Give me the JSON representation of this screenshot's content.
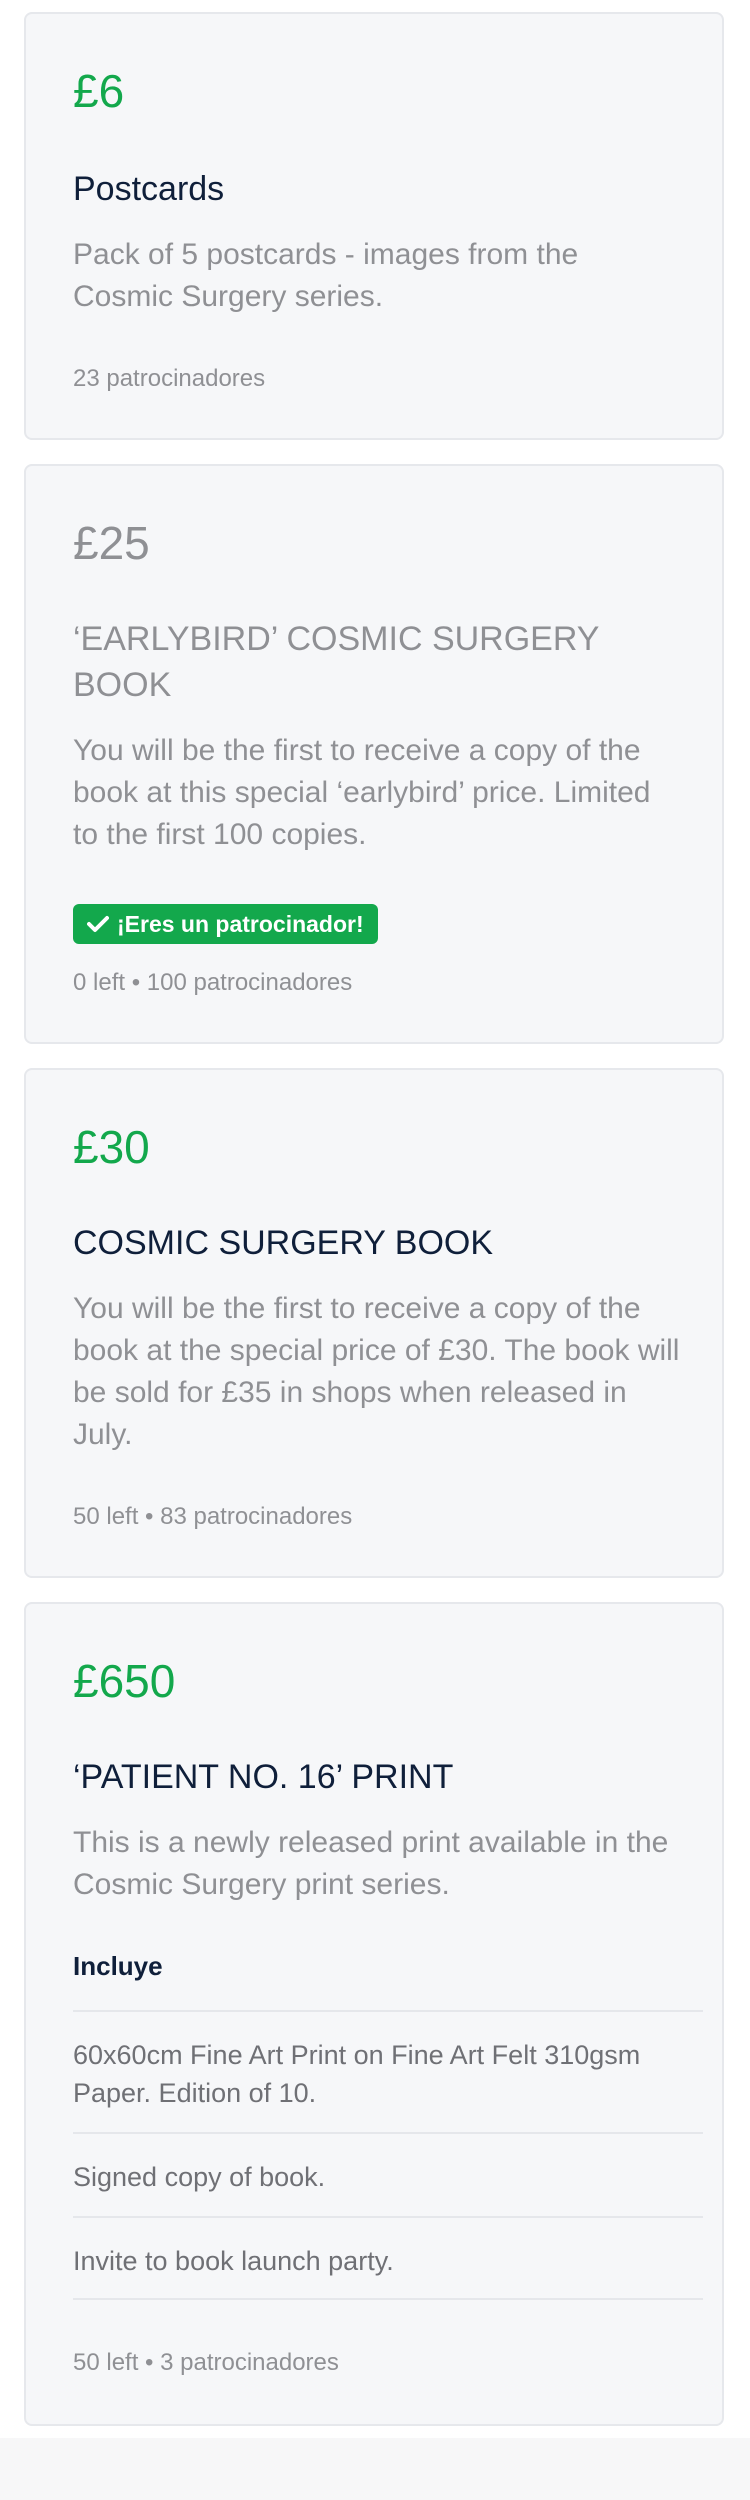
{
  "rewards": [
    {
      "price": "£6",
      "title": "Postcards",
      "description": "Pack of 5 postcards - images from the Cosmic Surgery series.",
      "meta": "23 patrocinadores"
    },
    {
      "price": "£25",
      "title": "‘EARLYBIRD’ COSMIC SURGERY BOOK",
      "description": "You will be the first to receive a copy of the book at this special ‘earlybird’ price. Limited to the first 100 copies.",
      "badge": "¡Eres un patrocinador!",
      "meta": "0 left • 100 patrocinadores"
    },
    {
      "price": "£30",
      "title": "COSMIC SURGERY BOOK",
      "description": "You will be the first to receive a copy of the book at the special price of £30. The book will be sold for £35 in shops when released in July.",
      "meta": "50 left • 83 patrocinadores"
    },
    {
      "price": "£650",
      "title": "‘PATIENT NO. 16’ PRINT",
      "description": "This is a newly released print available in the Cosmic Surgery print series.",
      "includes_label": "Incluye",
      "includes": [
        "60x60cm Fine Art Print on Fine Art Felt 310gsm Paper. Edition of 10.",
        "Signed copy of book.",
        "Invite to book launch party."
      ],
      "meta": "50 left • 3 patrocinadores"
    }
  ],
  "colors": {
    "price": "#13a84c",
    "price_muted": "#8f9094",
    "title": "#0f1f3a",
    "muted_text": "#8f9094",
    "card_bg": "#f6f7f9",
    "badge_bg": "#13a84c"
  }
}
